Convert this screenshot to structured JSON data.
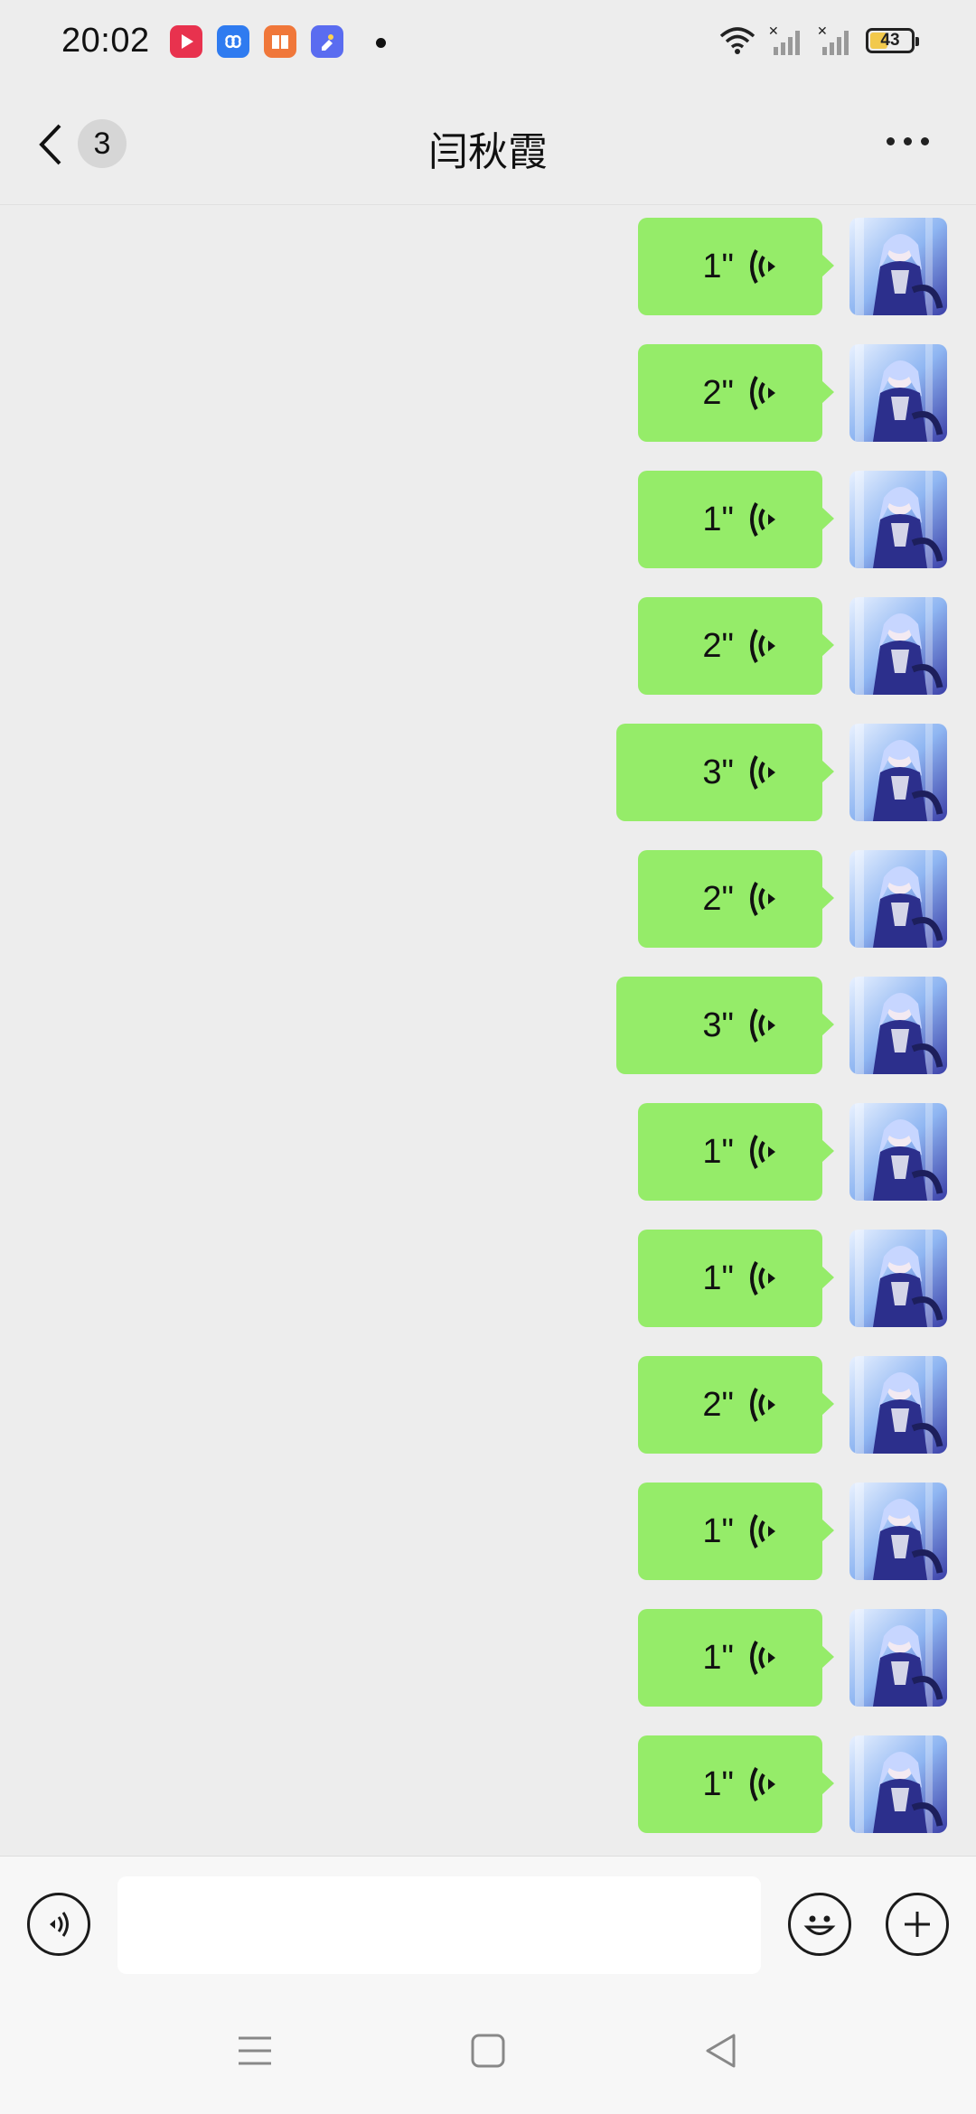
{
  "status_bar": {
    "time": "20:02",
    "app_icons": [
      "video-app-icon",
      "cloud-app-icon",
      "reader-app-icon",
      "tools-app-icon"
    ],
    "battery_level": "43",
    "battery_fraction": 0.43
  },
  "header": {
    "unread_count": "3",
    "title": "闫秋霞"
  },
  "messages": [
    {
      "duration": "1\""
    },
    {
      "duration": "2\""
    },
    {
      "duration": "1\""
    },
    {
      "duration": "2\""
    },
    {
      "duration": "3\""
    },
    {
      "duration": "2\""
    },
    {
      "duration": "3\""
    },
    {
      "duration": "1\""
    },
    {
      "duration": "1\""
    },
    {
      "duration": "2\""
    },
    {
      "duration": "1\""
    },
    {
      "duration": "1\""
    },
    {
      "duration": "1\""
    }
  ],
  "input": {
    "value": "",
    "placeholder": ""
  },
  "colors": {
    "bubble": "#95ec69",
    "background": "#ededed",
    "bar": "#f7f7f7"
  }
}
